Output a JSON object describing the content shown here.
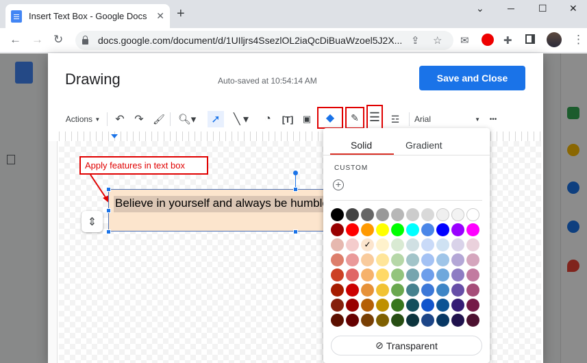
{
  "browser": {
    "tab_title": "Insert Text Box - Google Docs",
    "tab_close": "✕",
    "new_tab": "+",
    "url": "docs.google.com/document/d/1UIljrs4SsezlOL2iaQcDiBuaWzoel5J2X...",
    "window_controls": [
      "⌄",
      "─",
      "☐",
      "✕"
    ]
  },
  "drawing": {
    "title": "Drawing",
    "autosave": "Auto-saved at 10:54:14 AM",
    "save_close": "Save and Close",
    "toolbar": {
      "actions": "Actions",
      "font": "Arial",
      "more": "•••"
    }
  },
  "annotation": "Apply features in text box",
  "textbox_text": "Believe in yourself and always be humble",
  "palette": {
    "tab_solid": "Solid",
    "tab_gradient": "Gradient",
    "custom_label": "CUSTOM",
    "add_custom": "+",
    "selected_check": "✓",
    "transparent_label": "Transparent",
    "colors": [
      [
        "#000000",
        "#434343",
        "#666666",
        "#999999",
        "#b7b7b7",
        "#cccccc",
        "#d9d9d9",
        "#efefef",
        "#f3f3f3",
        "#ffffff"
      ],
      [
        "#980000",
        "#ff0000",
        "#ff9900",
        "#ffff00",
        "#00ff00",
        "#00ffff",
        "#4a86e8",
        "#0000ff",
        "#9900ff",
        "#ff00ff"
      ],
      [
        "#e6b8af",
        "#f4cccc",
        "#fce5cd",
        "#fff2cc",
        "#d9ead3",
        "#d0e0e3",
        "#c9daf8",
        "#cfe2f3",
        "#d9d2e9",
        "#ead1dc"
      ],
      [
        "#dd7e6b",
        "#ea9999",
        "#f9cb9c",
        "#ffe599",
        "#b6d7a8",
        "#a2c4c9",
        "#a4c2f4",
        "#9fc5e8",
        "#b4a7d6",
        "#d5a6bd"
      ],
      [
        "#cc4125",
        "#e06666",
        "#f6b26b",
        "#ffd966",
        "#93c47d",
        "#76a5af",
        "#6d9eeb",
        "#6fa8dc",
        "#8e7cc3",
        "#c27ba0"
      ],
      [
        "#a61c00",
        "#cc0000",
        "#e69138",
        "#f1c232",
        "#6aa84f",
        "#45818e",
        "#3c78d8",
        "#3d85c6",
        "#674ea7",
        "#a64d79"
      ],
      [
        "#85200c",
        "#990000",
        "#b45f06",
        "#bf9000",
        "#38761d",
        "#134f5c",
        "#1155cc",
        "#0b5394",
        "#351c75",
        "#741b47"
      ],
      [
        "#5b0f00",
        "#660000",
        "#783f04",
        "#7f6000",
        "#274e13",
        "#0c343d",
        "#1c4587",
        "#073763",
        "#20124d",
        "#4c1130"
      ]
    ],
    "selected": "#fce5cd"
  }
}
